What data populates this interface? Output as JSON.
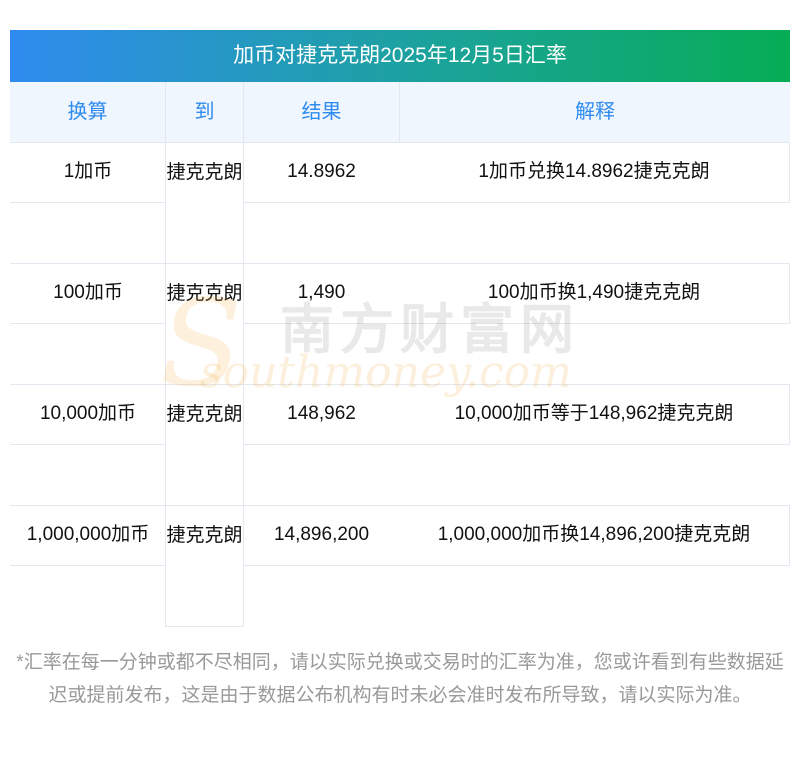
{
  "title": "加币对捷克克朗2025年12月5日汇率",
  "headers": [
    "换算",
    "到",
    "结果",
    "解释"
  ],
  "rows": [
    {
      "from": "1加币",
      "to": "捷克克朗",
      "result": "14.8962",
      "explain": "1加币兑换14.8962捷克克朗"
    },
    {
      "from": "100加币",
      "to": "捷克克朗",
      "result": "1,490",
      "explain": "100加币换1,490捷克克朗"
    },
    {
      "from": "10,000加币",
      "to": "捷克克朗",
      "result": "148,962",
      "explain": "10,000加币等于148,962捷克克朗"
    },
    {
      "from": "1,000,000加币",
      "to": "捷克克朗",
      "result": "14,896,200",
      "explain": "1,000,000加币换14,896,200捷克克朗"
    }
  ],
  "watermark": {
    "cn": "南方财富网",
    "en": "southmoney.com"
  },
  "note": "*汇率在每一分钟或都不尽相同，请以实际兑换或交易时的汇率为准，您或许看到有些数据延迟或提前发布，这是由于数据公布机构有时未必会准时发布所导致，请以实际为准。"
}
